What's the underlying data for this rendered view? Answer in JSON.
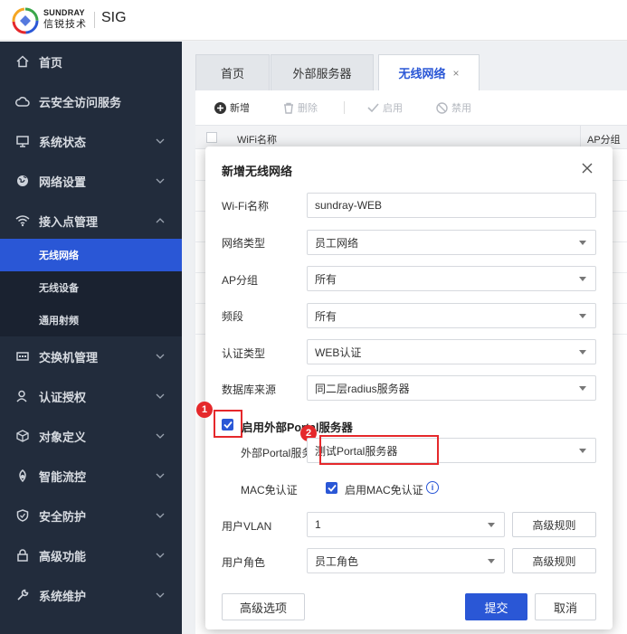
{
  "brand": {
    "en": "SUNDRAY",
    "cn": "信锐技术",
    "product": "SIG"
  },
  "sidebar": {
    "items": [
      {
        "label": "首页",
        "icon": "home-icon"
      },
      {
        "label": "云安全访问服务",
        "icon": "cloud-icon"
      },
      {
        "label": "系统状态",
        "icon": "monitor-icon"
      },
      {
        "label": "网络设置",
        "icon": "globe-icon"
      },
      {
        "label": "接入点管理",
        "icon": "wifi-icon"
      },
      {
        "label": "交换机管理",
        "icon": "switch-icon"
      },
      {
        "label": "认证授权",
        "icon": "user-icon"
      },
      {
        "label": "对象定义",
        "icon": "cube-icon"
      },
      {
        "label": "智能流控",
        "icon": "flow-icon"
      },
      {
        "label": "安全防护",
        "icon": "shield-icon"
      },
      {
        "label": "高级功能",
        "icon": "lock-icon"
      },
      {
        "label": "系统维护",
        "icon": "wrench-icon"
      }
    ],
    "subitems": [
      {
        "label": "无线网络",
        "active": true
      },
      {
        "label": "无线设备"
      },
      {
        "label": "通用射频"
      }
    ]
  },
  "tabs": [
    {
      "label": "首页"
    },
    {
      "label": "外部服务器"
    },
    {
      "label": "无线网络",
      "active": true,
      "close": "×"
    }
  ],
  "toolbar": {
    "add": "新增",
    "delete": "删除",
    "enable": "启用",
    "disable": "禁用"
  },
  "table": {
    "headers": [
      "WiFi名称",
      "AP分组"
    ]
  },
  "modal": {
    "title": "新增无线网络",
    "fields": {
      "wifi_name": {
        "label": "Wi-Fi名称",
        "value": "sundray-WEB"
      },
      "network_type": {
        "label": "网络类型",
        "value": "员工网络"
      },
      "ap_group": {
        "label": "AP分组",
        "value": "所有"
      },
      "band": {
        "label": "频段",
        "value": "所有"
      },
      "auth_type": {
        "label": "认证类型",
        "value": "WEB认证"
      },
      "db_source": {
        "label": "数据库来源",
        "value": "同二层radius服务器"
      }
    },
    "portal": {
      "enable_label": "启用外部Portal服务器",
      "server_label": "外部Portal服务器",
      "server_value": "测试Portal服务器",
      "mac_label": "MAC免认证",
      "mac_enable_label": "启用MAC免认证",
      "info_glyph": "i"
    },
    "vlan": {
      "label": "用户VLAN",
      "value": "1",
      "adv": "高级规则"
    },
    "role": {
      "label": "用户角色",
      "value": "员工角色",
      "adv": "高级规则"
    },
    "footer": {
      "advanced": "高级选项",
      "submit": "提交",
      "cancel": "取消"
    },
    "badges": [
      "1",
      "2"
    ]
  },
  "colors": {
    "accent": "#2a57d6",
    "sidebar_bg": "#222c3c",
    "highlight_red": "#e5282b"
  }
}
